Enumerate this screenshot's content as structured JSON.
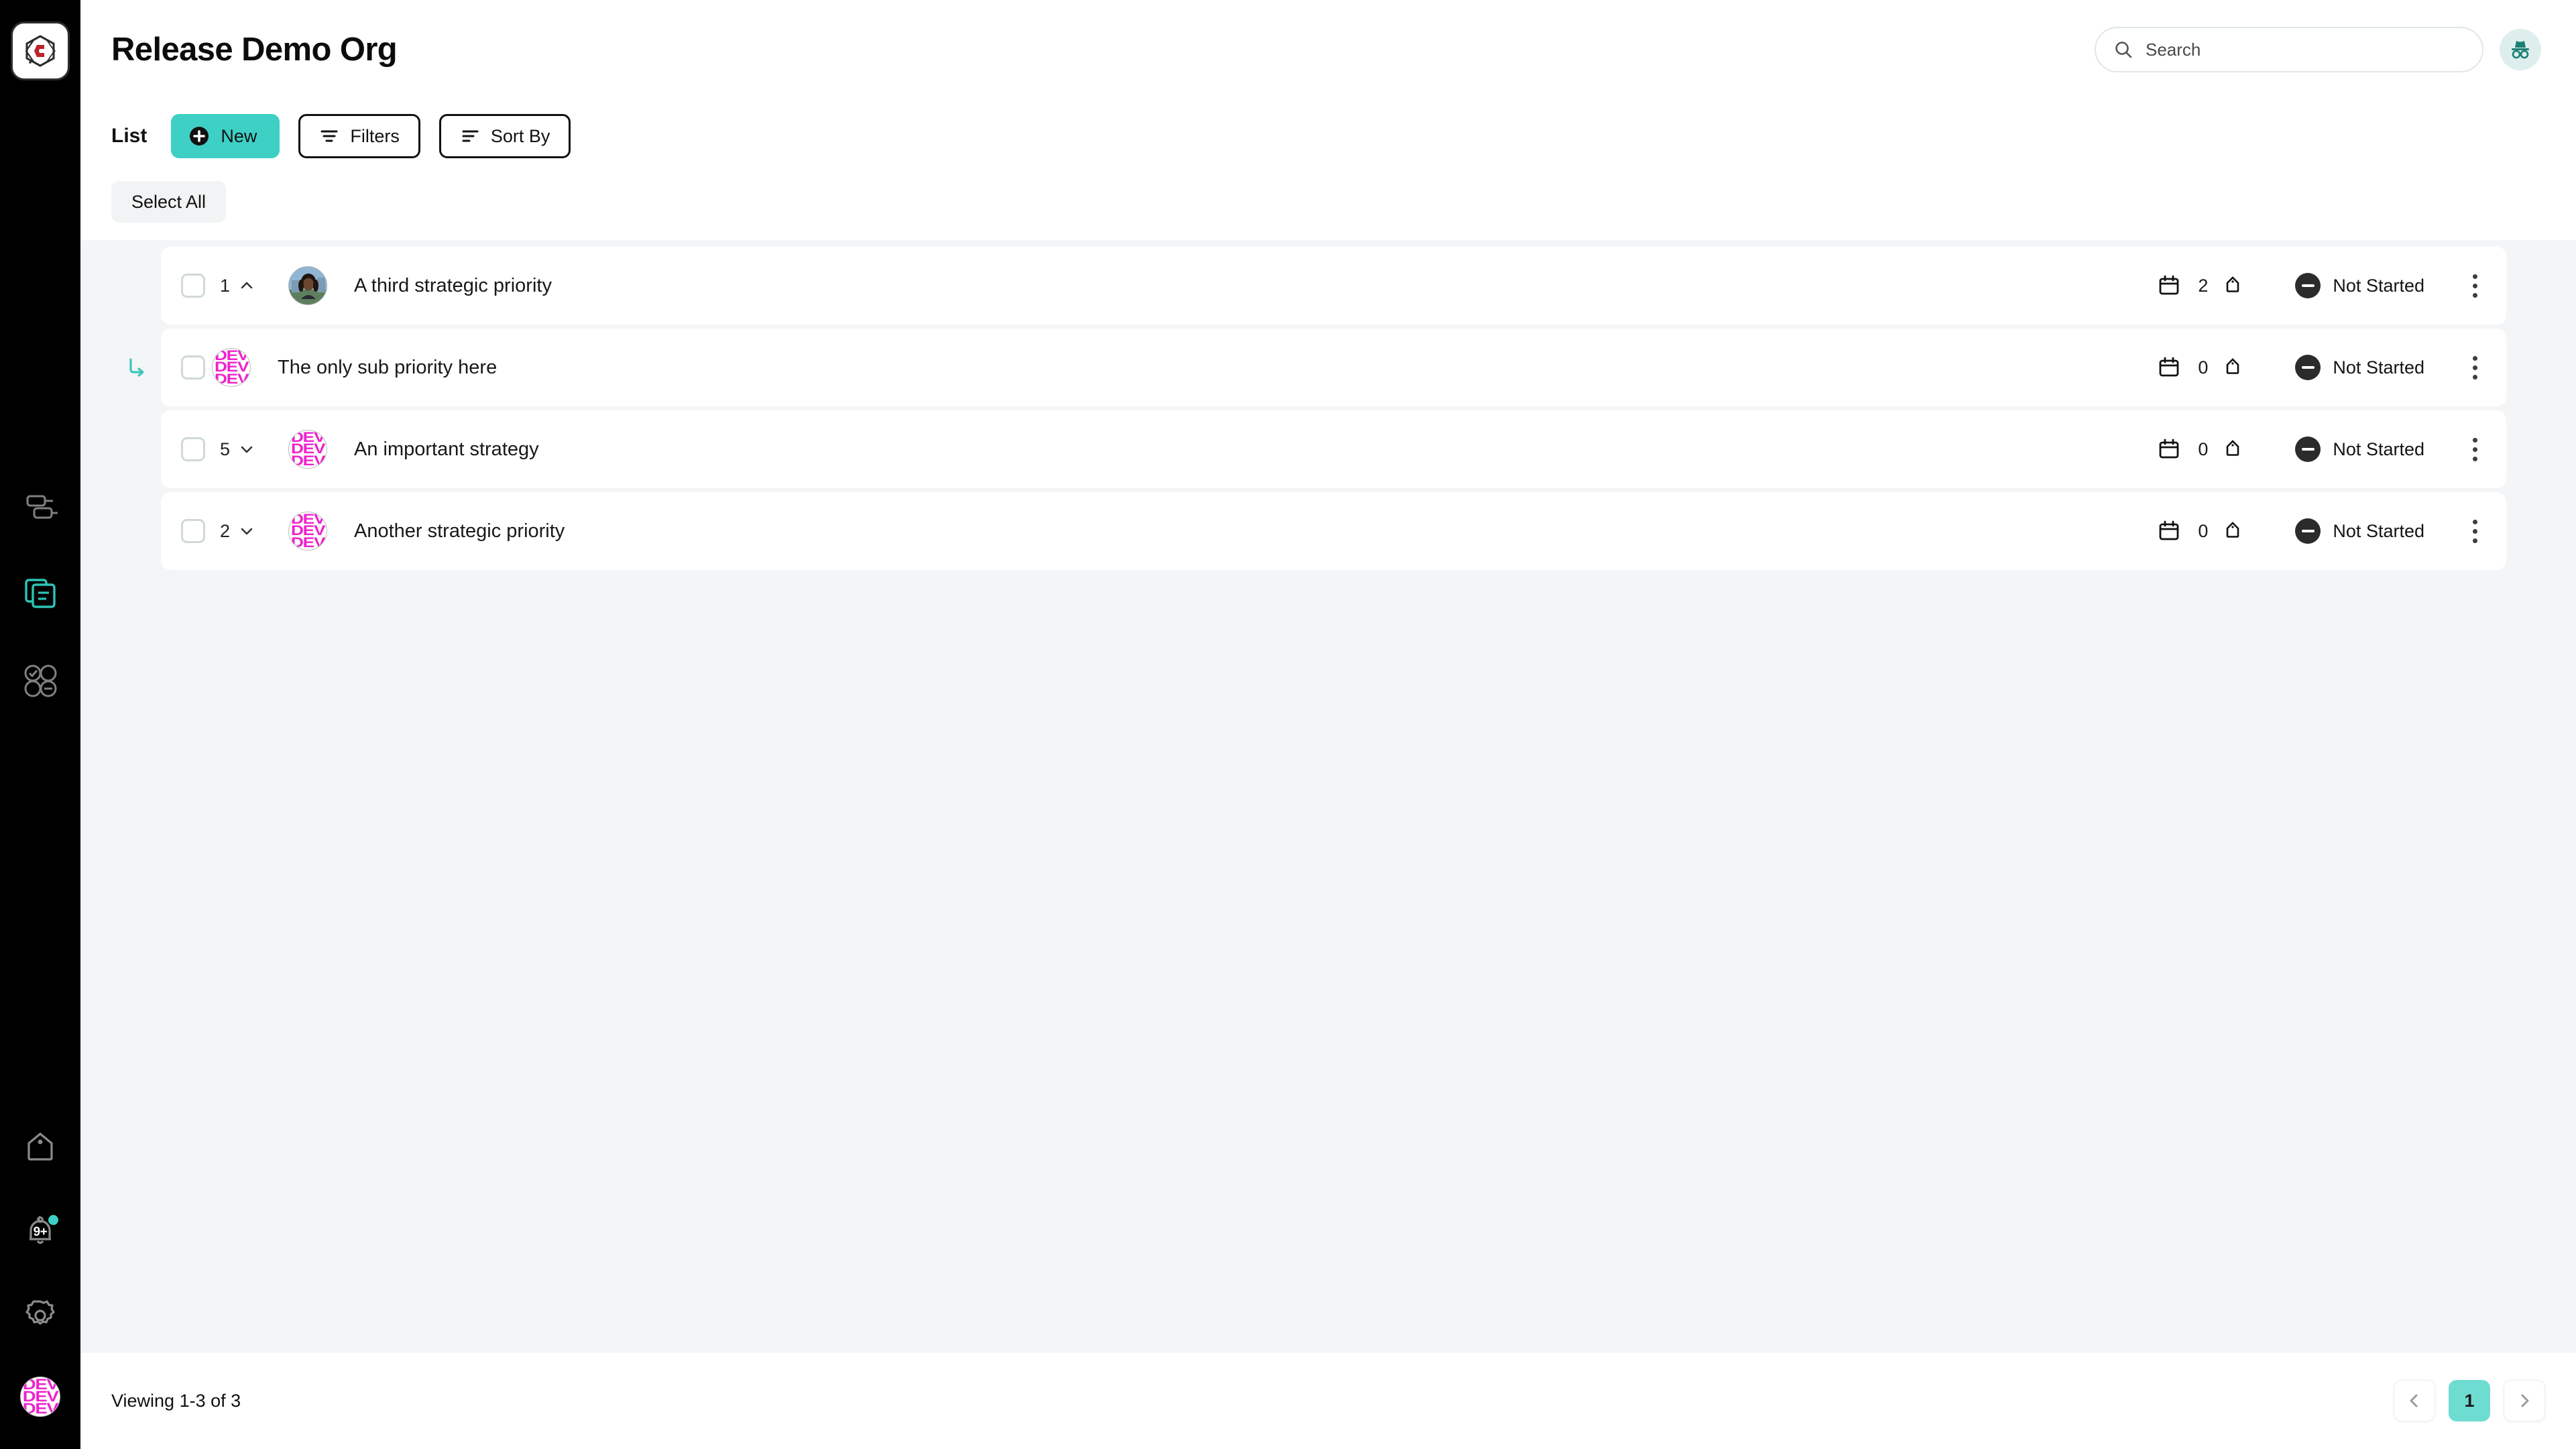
{
  "theme": {
    "accent": "#3ed0c4",
    "accent_soft": "#6fdcd2",
    "sidebar_bg": "#000000",
    "list_bg": "#f4f5f6",
    "status_dark": "#2b2b2b",
    "avatar_pink": "#ee22cc"
  },
  "sidebar": {
    "logo": {
      "name": "app-logo",
      "letter": "C"
    },
    "items": [
      {
        "icon": "gantt-chart-icon",
        "label": "Roadmap",
        "active": false
      },
      {
        "icon": "documents-icon",
        "label": "Items",
        "active": true
      },
      {
        "icon": "circles-grid-icon",
        "label": "Dashboard",
        "active": false
      }
    ],
    "bottom": [
      {
        "icon": "home-tag-icon",
        "label": "Home"
      },
      {
        "icon": "bell-icon",
        "label": "Notifications",
        "badge": "9+"
      },
      {
        "icon": "gear-icon",
        "label": "Settings"
      },
      {
        "icon": "user-avatar",
        "label": "Account",
        "initials": "DEV"
      }
    ]
  },
  "header": {
    "title": "Release Demo Org"
  },
  "search": {
    "placeholder": "Search",
    "icon": "search-icon"
  },
  "incognito": {
    "icon": "incognito-icon",
    "label": "Incognito mode"
  },
  "toolbar": {
    "view_label": "List",
    "new_label": "New",
    "new_icon": "plus-circle-icon",
    "filters_label": "Filters",
    "filters_icon": "filter-icon",
    "sort_label": "Sort By",
    "sort_icon": "sort-icon",
    "select_all_label": "Select All"
  },
  "list": {
    "rows": [
      {
        "id": "row-1",
        "sub": false,
        "child_count": "1",
        "expanded": true,
        "chevron": "chevron-up-icon",
        "avatar_type": "photo",
        "avatar_initials": "",
        "title": "A third strategic priority",
        "date_icon": "calendar-icon",
        "tag_count": "2",
        "tag_icon": "tag-icon",
        "status_icon": "minus-circle-icon",
        "status": "Not Started",
        "menu_icon": "kebab-menu-icon"
      },
      {
        "id": "row-1-sub-1",
        "sub": true,
        "sub_icon": "corner-down-right-icon",
        "child_count": "",
        "expanded": false,
        "chevron": "",
        "avatar_type": "initials",
        "avatar_initials": "DEV",
        "title": "The only sub priority here",
        "date_icon": "calendar-icon",
        "tag_count": "0",
        "tag_icon": "tag-icon",
        "status_icon": "minus-circle-icon",
        "status": "Not Started",
        "menu_icon": "kebab-menu-icon"
      },
      {
        "id": "row-2",
        "sub": false,
        "child_count": "5",
        "expanded": false,
        "chevron": "chevron-down-icon",
        "avatar_type": "initials",
        "avatar_initials": "DEV",
        "title": "An important strategy",
        "date_icon": "calendar-icon",
        "tag_count": "0",
        "tag_icon": "tag-icon",
        "status_icon": "minus-circle-icon",
        "status": "Not Started",
        "menu_icon": "kebab-menu-icon"
      },
      {
        "id": "row-3",
        "sub": false,
        "child_count": "2",
        "expanded": false,
        "chevron": "chevron-down-icon",
        "avatar_type": "initials",
        "avatar_initials": "DEV",
        "title": "Another strategic priority",
        "date_icon": "calendar-icon",
        "tag_count": "0",
        "tag_icon": "tag-icon",
        "status_icon": "minus-circle-icon",
        "status": "Not Started",
        "menu_icon": "kebab-menu-icon"
      }
    ]
  },
  "footer": {
    "viewing": "Viewing 1-3 of 3",
    "prev_icon": "chevron-left-icon",
    "next_icon": "chevron-right-icon",
    "pages": [
      "1"
    ],
    "active_page": "1"
  }
}
